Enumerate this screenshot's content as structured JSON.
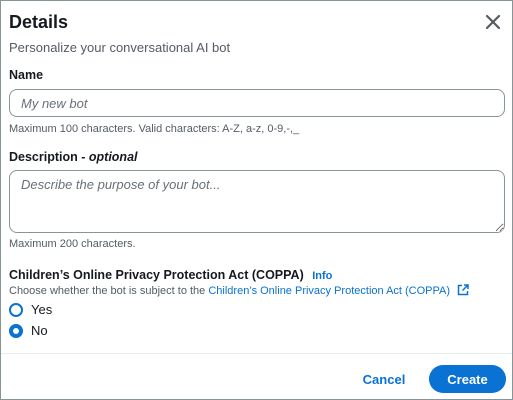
{
  "dialog": {
    "title": "Details",
    "subtitle": "Personalize your conversational AI bot",
    "close_icon": "close-icon"
  },
  "name_field": {
    "label": "Name",
    "placeholder": "My new bot",
    "value": "",
    "hint": "Maximum 100 characters. Valid characters: A-Z, a-z, 0-9,-,_"
  },
  "description_field": {
    "label": "Description",
    "label_optional": "- optional",
    "placeholder": "Describe the purpose of your bot...",
    "value": "",
    "hint": "Maximum 200 characters."
  },
  "coppa": {
    "label": "Children’s Online Privacy Protection Act (COPPA)",
    "info_link": "Info",
    "description": "Choose whether the bot is subject to the",
    "link_text": "Children’s Online Privacy Protection Act (COPPA)",
    "link_icon": "external-link-icon",
    "options": [
      {
        "label": "Yes",
        "checked": false
      },
      {
        "label": "No",
        "checked": true
      }
    ]
  },
  "footer": {
    "cancel_label": "Cancel",
    "create_label": "Create"
  },
  "colors": {
    "accent": "#0972d3",
    "text": "#16191f",
    "secondary_text": "#545b64",
    "border": "#879596"
  }
}
